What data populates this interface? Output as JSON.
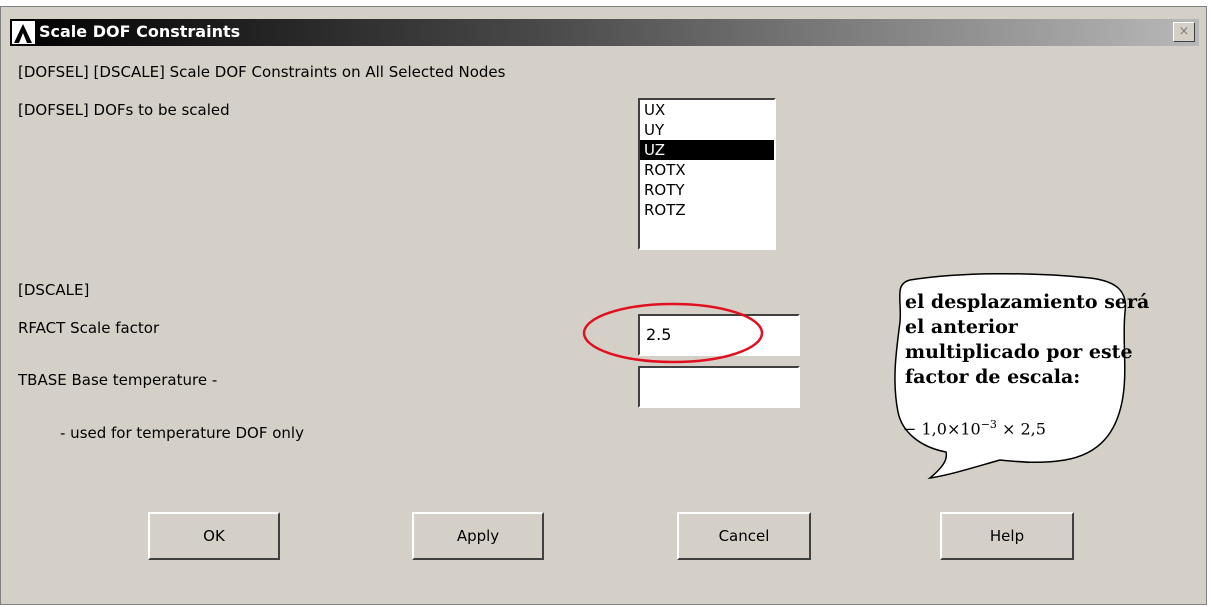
{
  "dialog": {
    "title": "Scale DOF Constraints",
    "close_label": "×"
  },
  "header_text": "[DOFSEL] [DSCALE]  Scale DOF Constraints on All Selected Nodes",
  "dofsel": {
    "label": "[DOFSEL]  DOFs to be scaled",
    "options": [
      "UX",
      "UY",
      "UZ",
      "ROTX",
      "ROTY",
      "ROTZ"
    ],
    "selected": "UZ"
  },
  "dscale": {
    "section_label": "[DSCALE]",
    "rfact_label": "RFACT  Scale factor",
    "rfact_value": "2.5",
    "tbase_label": "TBASE  Base temperature -",
    "tbase_value": "",
    "tbase_note": "- used for temperature DOF only"
  },
  "buttons": {
    "ok": "OK",
    "apply": "Apply",
    "cancel": "Cancel",
    "help": "Help"
  },
  "annotation": {
    "lines": [
      "el desplazamiento será",
      "el anterior",
      "multiplicado por este",
      "factor de escala:"
    ],
    "formula_prefix": "− 1,0×10",
    "formula_exp": "−3",
    "formula_suffix": " × 2,5",
    "highlight_color": "#e01020"
  }
}
